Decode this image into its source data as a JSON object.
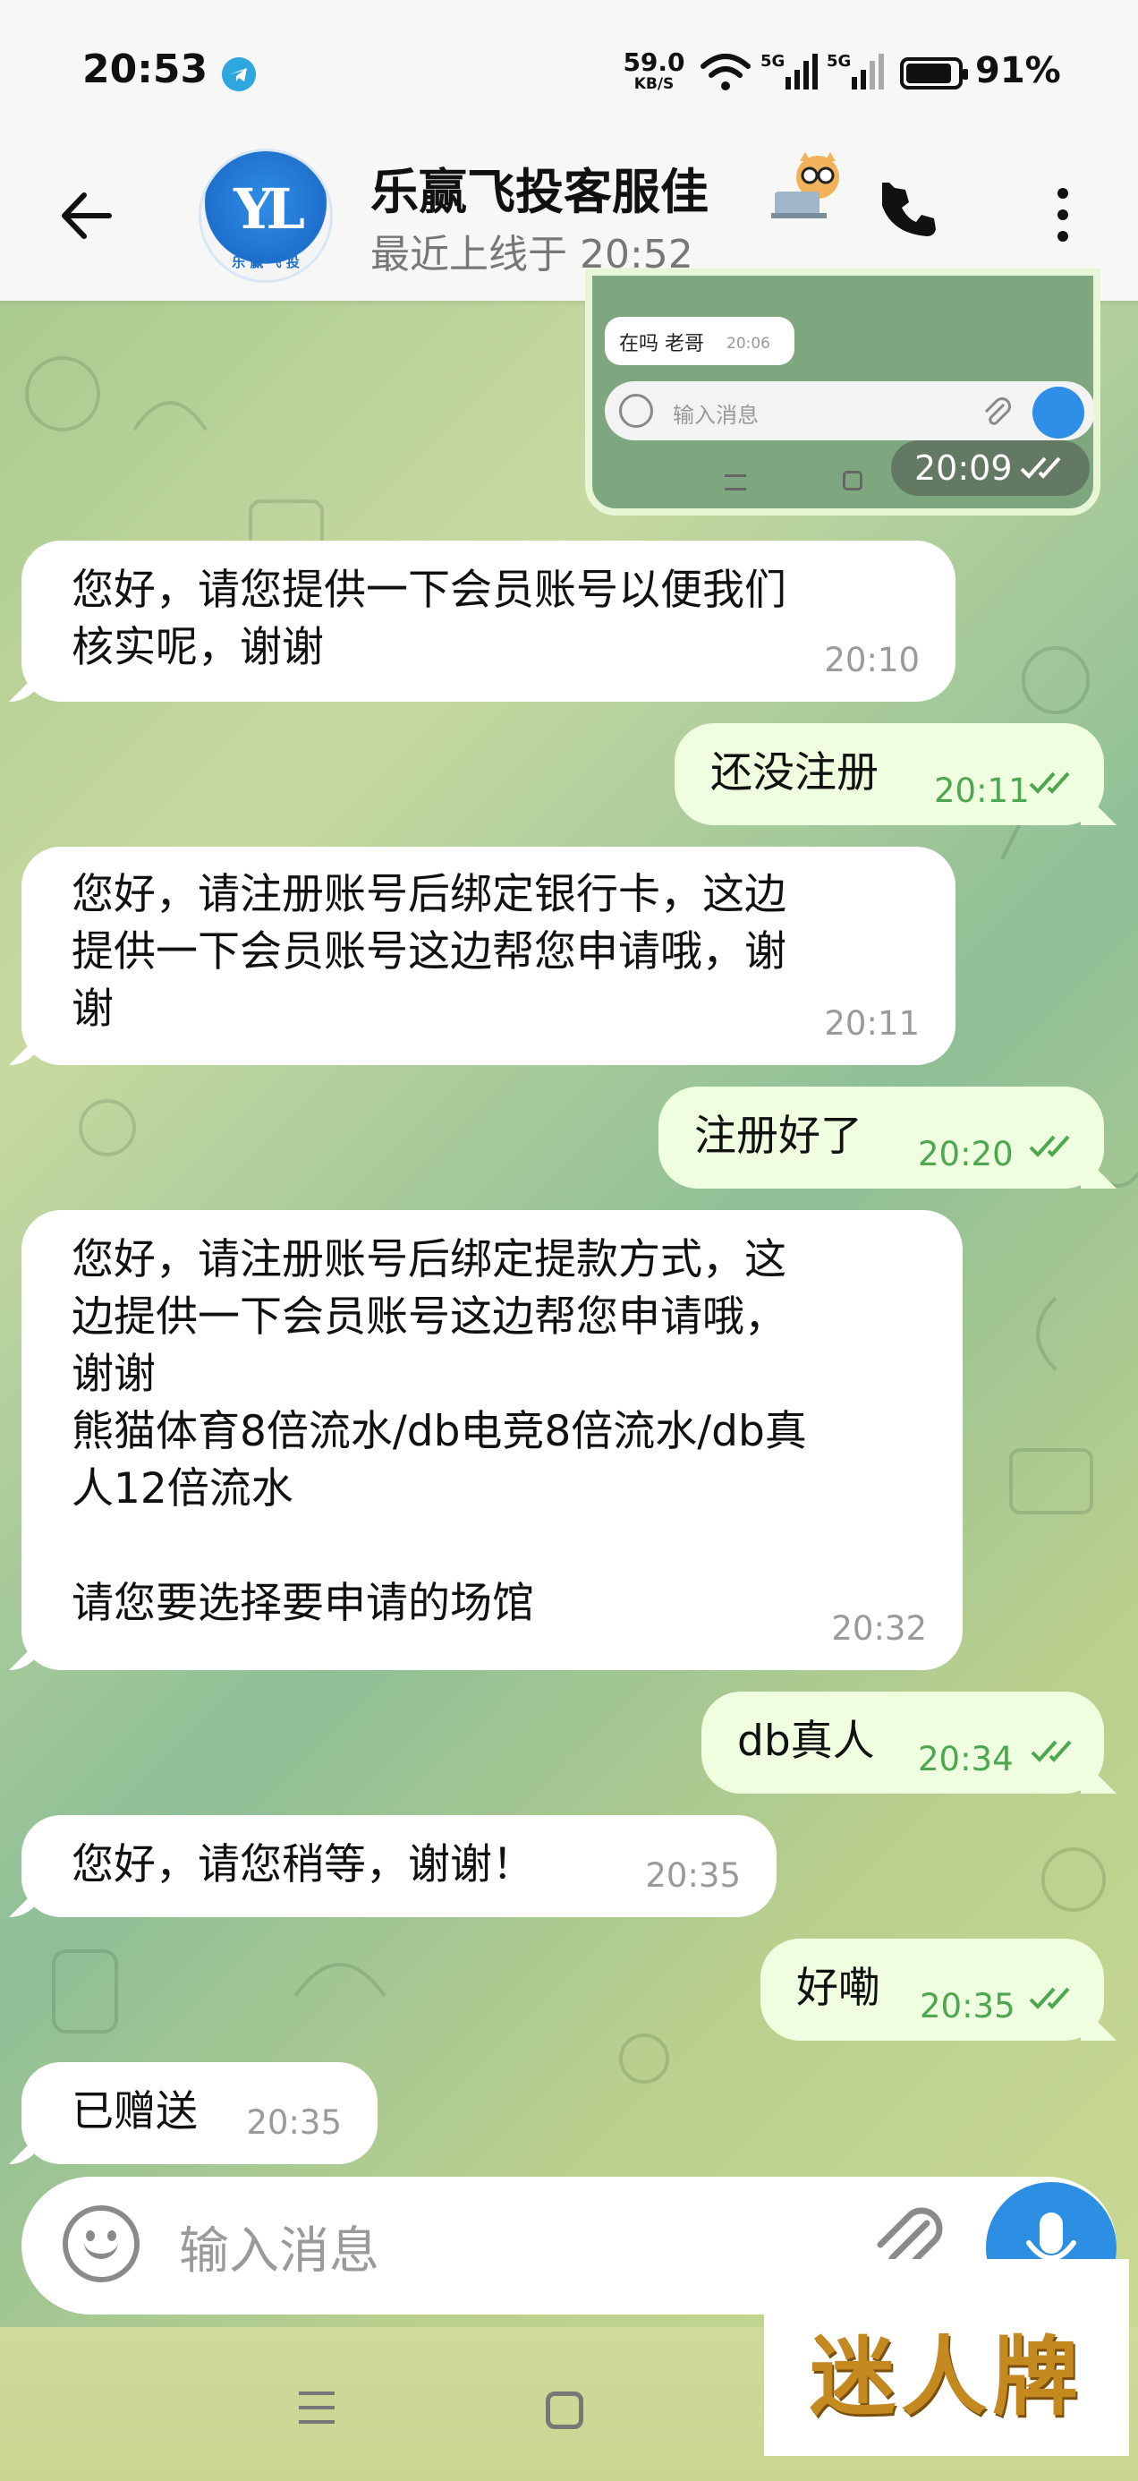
{
  "status_bar": {
    "time": "20:53",
    "net_speed_value": "59.0",
    "net_speed_unit": "KB/S",
    "sig1_label": "5G",
    "sig2_label": "5G",
    "battery_percent": "91%",
    "battery_level": 0.91
  },
  "header": {
    "avatar_mark": "YL",
    "avatar_ring": "乐 赢 飞 投",
    "title": "乐赢飞投客服佳",
    "last_seen": "最近上线于 20:52"
  },
  "preview": {
    "bubble_text": "在吗 老哥",
    "bubble_time": "20:06",
    "input_placeholder": "输入消息",
    "time": "20:09"
  },
  "messages": [
    {
      "dir": "in",
      "text": "您好，请您提供一下会员账号以便我们\n核实呢，谢谢",
      "time": "20:10"
    },
    {
      "dir": "out",
      "text": "还没注册",
      "time": "20:11"
    },
    {
      "dir": "in",
      "text": "您好，请注册账号后绑定银行卡，这边\n提供一下会员账号这边帮您申请哦，谢\n谢",
      "time": "20:11"
    },
    {
      "dir": "out",
      "text": "注册好了",
      "time": "20:20"
    },
    {
      "dir": "in",
      "text": "您好，请注册账号后绑定提款方式，这\n边提供一下会员账号这边帮您申请哦，\n谢谢\n熊猫体育8倍流水/db电竞8倍流水/db真\n人12倍流水\n\n请您要选择要申请的场馆",
      "time": "20:32"
    },
    {
      "dir": "out",
      "text": "db真人",
      "time": "20:34"
    },
    {
      "dir": "in",
      "text": "您好，请您稍等，谢谢！",
      "time": "20:35"
    },
    {
      "dir": "out",
      "text": "好嘞",
      "time": "20:35"
    },
    {
      "dir": "in",
      "text": "已赠送",
      "time": "20:35"
    }
  ],
  "composer": {
    "placeholder": "输入消息"
  },
  "watermark": "迷人牌",
  "colors": {
    "incoming_bubble": "#ffffff",
    "outgoing_bubble": "#eefedf",
    "read_ticks": "#4da750",
    "mic_button": "#2d8fe4",
    "telegram_dot": "#2ea6e0"
  }
}
